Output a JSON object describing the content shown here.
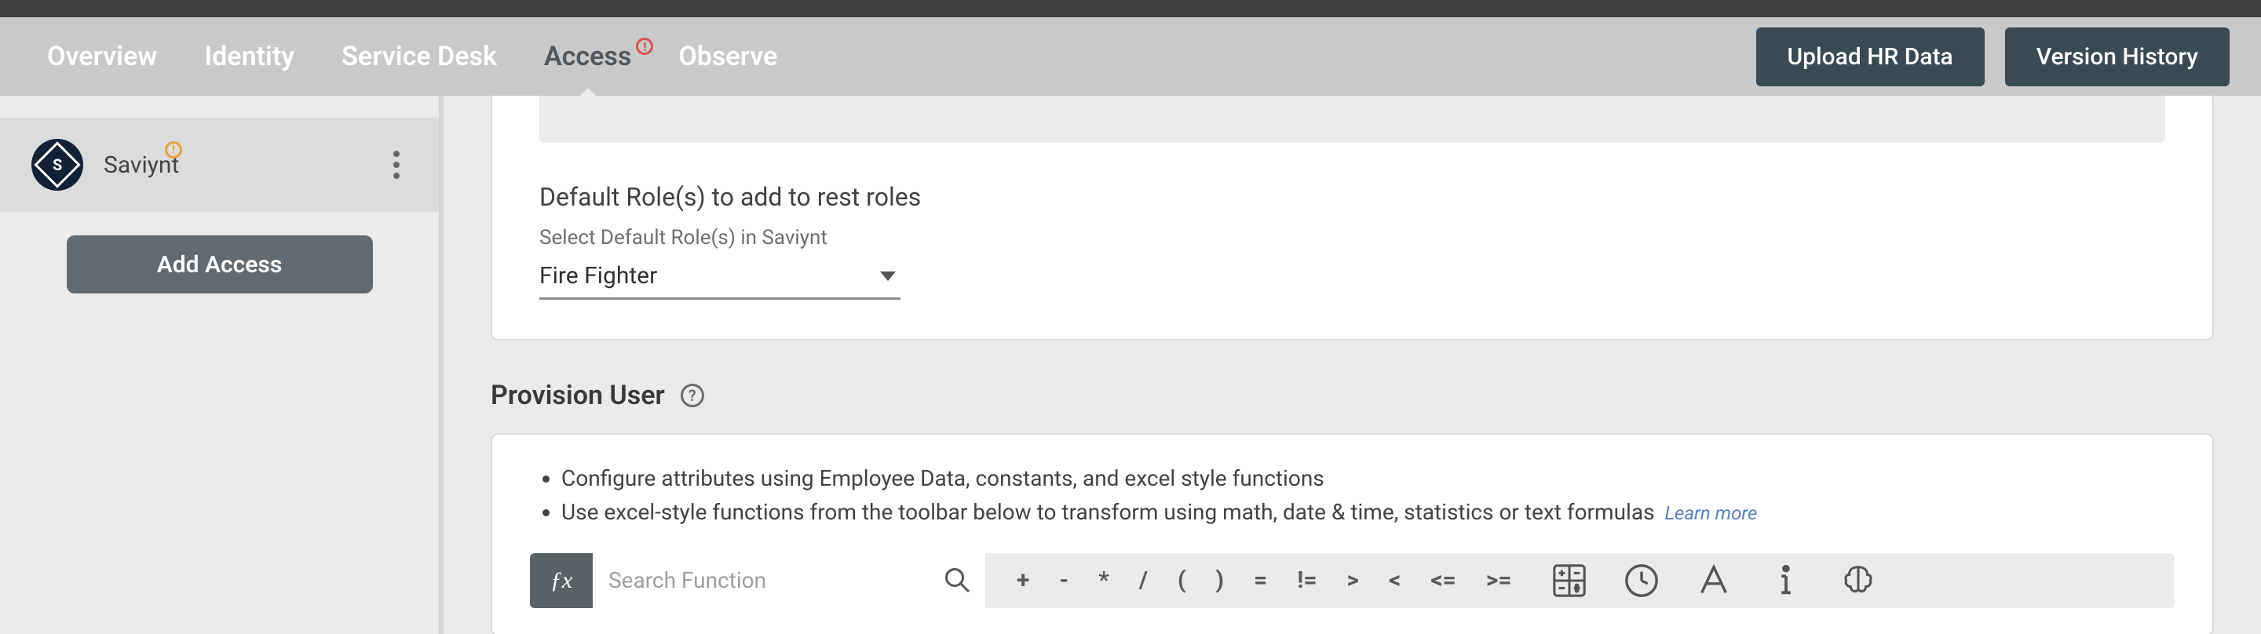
{
  "header": {
    "tabs": [
      "Overview",
      "Identity",
      "Service Desk",
      "Access",
      "Observe"
    ],
    "active_tab_index": 3,
    "buttons": {
      "upload": "Upload HR Data",
      "version": "Version History"
    }
  },
  "sidebar": {
    "app": {
      "initial": "S",
      "name": "Saviynt"
    },
    "add_access_label": "Add Access"
  },
  "roles": {
    "title": "Default Role(s) to add to rest roles",
    "select_label": "Select Default Role(s) in Saviynt",
    "selected": "Fire Fighter"
  },
  "provision": {
    "title": "Provision User",
    "bullets": [
      "Configure attributes using Employee Data, constants, and excel style functions",
      "Use excel-style functions from the toolbar below to transform using math, date & time, statistics or text formulas"
    ],
    "learn_more": "Learn more",
    "fx_label": "ƒx",
    "search_placeholder": "Search Function",
    "operators": [
      "+",
      "-",
      "*",
      "/",
      "(",
      ")",
      "=",
      "!=",
      ">",
      "<",
      "<=",
      ">="
    ]
  }
}
